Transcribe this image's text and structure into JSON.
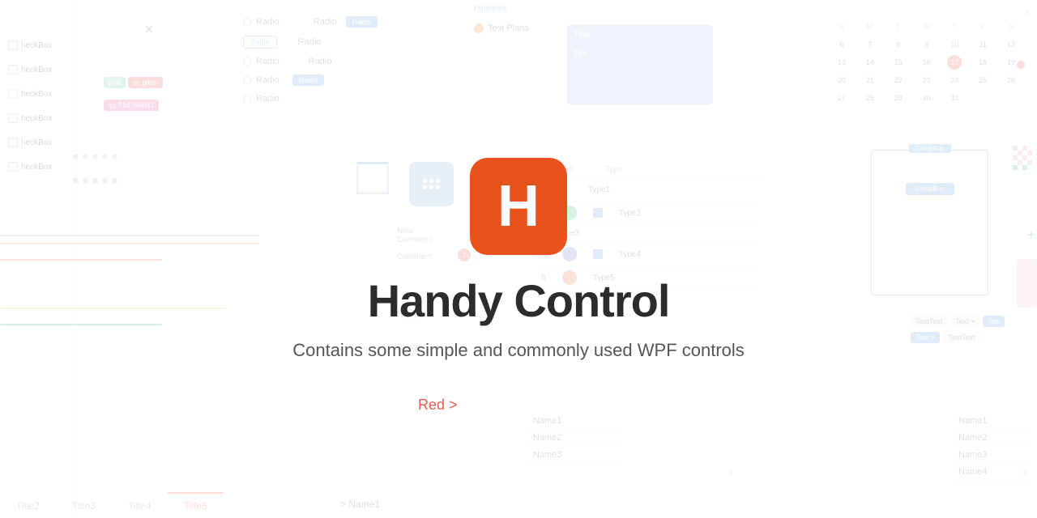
{
  "app": {
    "title": "Handy Control",
    "subtitle": "Contains some simple and commonly used WPF controls",
    "logo_letter": "H",
    "logo_bg": "#e8531d"
  },
  "bg": {
    "checkboxes": [
      "heckBox",
      "heckBox",
      "heckBox",
      "heckBox",
      "heckBox",
      "heckBox"
    ],
    "radio_labels": [
      "Radio",
      "Radio",
      "Radio",
      "Radio",
      "Radio",
      "Radio"
    ],
    "badges": [
      "chat",
      "on gitter",
      "qq 714704041"
    ],
    "pipelines_title": "Pipelines",
    "test_plans": "Test Plans",
    "table_header": [
      "Selected",
      "Type"
    ],
    "table_types": [
      "Type1",
      "Type2",
      "Type3",
      "Type4",
      "Type5"
    ],
    "groupbox_title": "GroupBox",
    "groupbox_inner": "GroupBox",
    "names": [
      "Name1",
      "Name2",
      "Name3"
    ],
    "title_tabs": [
      "Title2",
      "Title3",
      "Title4",
      "Title5"
    ],
    "name_tree": "> Name1",
    "red_arrow": "Red >"
  }
}
